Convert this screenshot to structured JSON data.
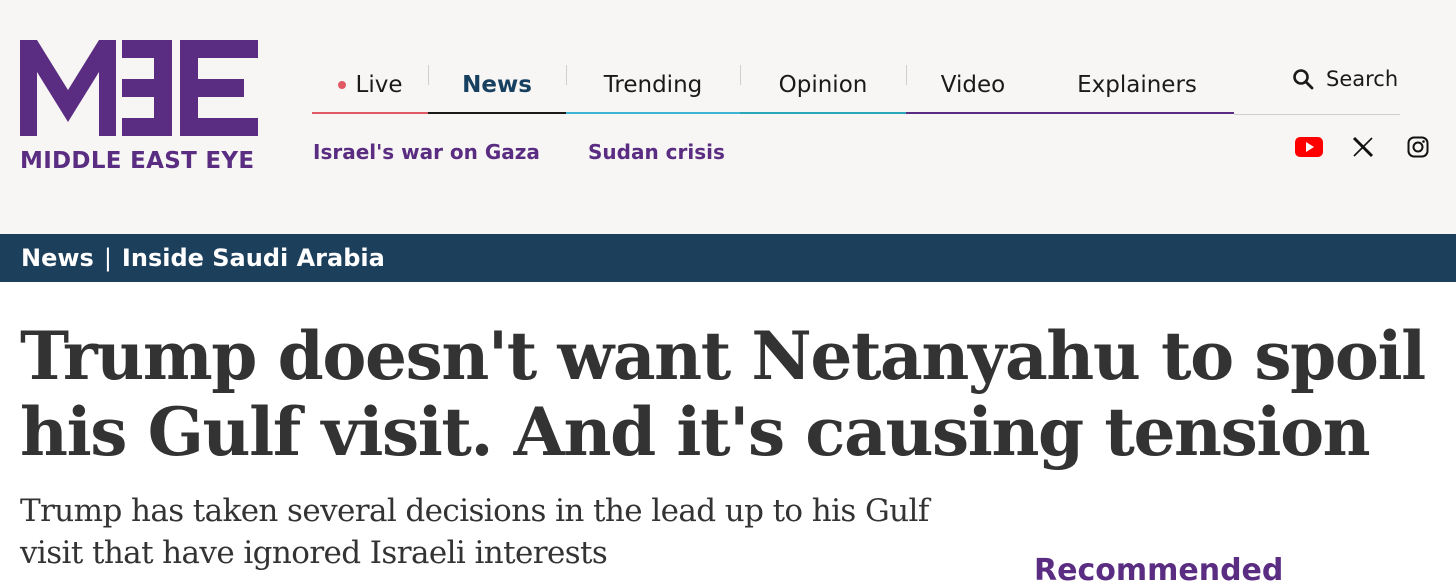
{
  "brand": {
    "name": "MIDDLE EAST EYE",
    "color": "#5a2d82"
  },
  "nav": {
    "items": [
      {
        "label": "Live",
        "color": "#e05a64"
      },
      {
        "label": "News",
        "color": "#1a1a1a"
      },
      {
        "label": "Trending",
        "color": "#3fb3d2"
      },
      {
        "label": "Opinion",
        "color": "#2aa8b8"
      },
      {
        "label": "Video",
        "color": "#5a2d82"
      },
      {
        "label": "Explainers",
        "color": "#5a2d82"
      }
    ],
    "search_label": "Search"
  },
  "hot_topics": [
    "Israel's war on Gaza",
    "Sudan crisis"
  ],
  "social": [
    "youtube-icon",
    "x-icon",
    "instagram-icon"
  ],
  "section": {
    "primary": "News",
    "separator": "|",
    "secondary": "Inside Saudi Arabia",
    "color": "#1c3f5c"
  },
  "article": {
    "headline": "Trump doesn't want Netanyahu to spoil his Gulf visit. And it's causing tension",
    "standfirst": "Trump has taken several decisions in the lead up to his Gulf visit that have ignored Israeli interests"
  },
  "sidebar": {
    "recommended_label": "Recommended"
  }
}
